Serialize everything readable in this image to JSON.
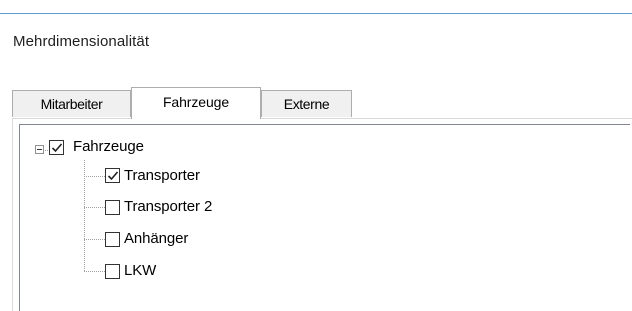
{
  "section": {
    "title": "Mehrdimensionalität"
  },
  "tabs": [
    {
      "label": "Mitarbeiter",
      "selected": false
    },
    {
      "label": "Fahrzeuge",
      "selected": true
    },
    {
      "label": "Externe",
      "selected": false
    }
  ],
  "tree": {
    "root": {
      "label": "Fahrzeuge",
      "checked": true,
      "expanded": true
    },
    "children": [
      {
        "label": "Transporter",
        "checked": true
      },
      {
        "label": "Transporter 2",
        "checked": false
      },
      {
        "label": "Anhänger",
        "checked": false
      },
      {
        "label": "LKW",
        "checked": false
      }
    ]
  },
  "colors": {
    "accent_line": "#5b9bd5",
    "tab_inactive": "#f0f0f0",
    "border": "#adadad"
  }
}
